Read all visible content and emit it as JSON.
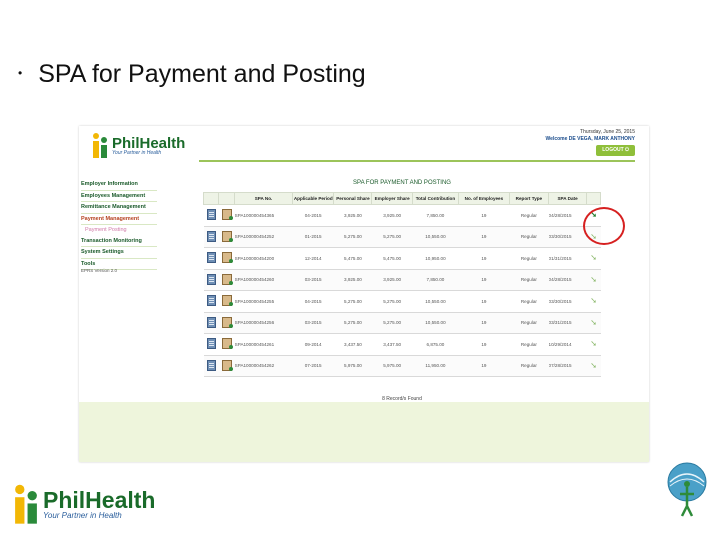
{
  "slide": {
    "bullet": "•",
    "title": "SPA for Payment and Posting"
  },
  "app": {
    "logo_name": "PhilHealth",
    "logo_tagline": "Your Partner in Health",
    "date": "Thursday, June 25, 2015",
    "welcome": "Welcome DE VEGA, MARK ANTHONY",
    "logout_label": "LOGOUT",
    "sidebar": {
      "items": [
        "Employer Information",
        "Employees Management",
        "Remittance Management",
        "Payment Management",
        "Payment Posting",
        "Transaction Monitoring",
        "System Settings",
        "Tools"
      ],
      "version": "EPRS Version 2.0"
    },
    "content_title": "SPA FOR PAYMENT AND POSTING",
    "columns": [
      "SPA No.",
      "Applicable Period",
      "Personal Share",
      "Employer Share",
      "Total Contribution",
      "No. of Employees",
      "Report Type",
      "SPA Date"
    ],
    "rows": [
      [
        "SPA100000454365",
        "04-2015",
        "3,925.00",
        "3,925.00",
        "7,850.00",
        "19",
        "Regular",
        "04/28/2015"
      ],
      [
        "SPA100000454252",
        "01-2015",
        "5,275.00",
        "5,275.00",
        "10,550.00",
        "19",
        "Regular",
        "03/30/2015"
      ],
      [
        "SPA100000454200",
        "12-2014",
        "5,475.00",
        "5,475.00",
        "10,950.00",
        "19",
        "Regular",
        "01/31/2015"
      ],
      [
        "SPA100000454260",
        "03-2015",
        "3,925.00",
        "3,925.00",
        "7,850.00",
        "19",
        "Regular",
        "04/28/2015"
      ],
      [
        "SPA100000454255",
        "04-2015",
        "5,275.00",
        "5,275.00",
        "10,550.00",
        "19",
        "Regular",
        "03/30/2015"
      ],
      [
        "SPA100000454256",
        "03-2015",
        "5,275.00",
        "5,275.00",
        "10,550.00",
        "19",
        "Regular",
        "03/31/2015"
      ],
      [
        "SPA100000454261",
        "09-2014",
        "3,437.50",
        "3,437.50",
        "6,875.00",
        "19",
        "Regular",
        "10/29/2014"
      ],
      [
        "SPA100000454262",
        "07-2015",
        "5,975.00",
        "5,975.00",
        "11,950.00",
        "19",
        "Regular",
        "07/28/2015"
      ]
    ],
    "records_found": "8 Record/s Found"
  },
  "footer": {
    "logo_name": "PhilHealth",
    "logo_tagline": "Your Partner in Health"
  },
  "colors": {
    "brand_green": "#1a6b2a",
    "accent_green": "#8fbf3a",
    "highlight_red": "#d62020",
    "tagline_blue": "#2a5e9c"
  }
}
